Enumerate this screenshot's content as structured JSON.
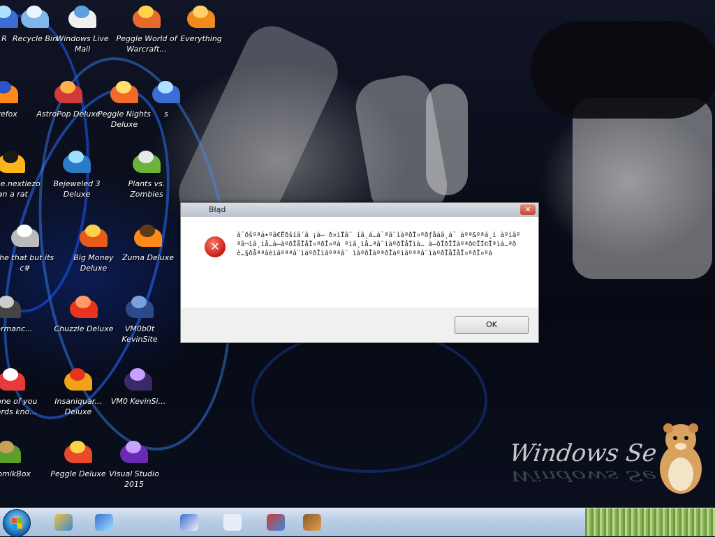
{
  "desktop": {
    "icons": [
      {
        "label": "R",
        "c1": "#3a6ed6",
        "c2": "#aee0ff"
      },
      {
        "label": "Recycle Bin",
        "c1": "#7fb7e8",
        "c2": "#e8f4ff"
      },
      {
        "label": "Windows Live Mail",
        "c1": "#f0f0f0",
        "c2": "#5da0e0"
      },
      {
        "label": "Peggle World of Warcraft...",
        "c1": "#e86a2a",
        "c2": "#ffd24a"
      },
      {
        "label": "Everything",
        "c1": "#f08a1a",
        "c2": "#ffcf6a"
      },
      {
        "label": "Firefox",
        "c1": "#ff8a1a",
        "c2": "#2a54c8"
      },
      {
        "label": "AstroPop Deluxe",
        "c1": "#d23a3a",
        "c2": "#ffb24a"
      },
      {
        "label": "Peggle Nights Deluxe",
        "c1": "#f06a2a",
        "c2": "#ffe06a"
      },
      {
        "label": "s",
        "c1": "#3a6ed6",
        "c2": "#aee0ff"
      },
      {
        "label": "nzone.nextlezo ran a rat",
        "c1": "#ffb41a",
        "c2": "#1a1a1a"
      },
      {
        "label": "Bejeweled 3 Deluxe",
        "c1": "#2a7ac8",
        "c2": "#9ae0ff"
      },
      {
        "label": "Plants vs. Zombies",
        "c1": "#6ab43a",
        "c2": "#e8e8e8"
      },
      {
        "label": "the that but its c#",
        "c1": "#bbbbbb",
        "c2": "#ffffff"
      },
      {
        "label": "Big Money Deluxe",
        "c1": "#e85a1a",
        "c2": "#ffd04a"
      },
      {
        "label": "Zuma Deluxe",
        "c1": "#ff8a1a",
        "c2": "#5a3a1a"
      },
      {
        "label": "endermanc...",
        "c1": "#444444",
        "c2": "#cccccc"
      },
      {
        "label": "Chuzzle Deluxe",
        "c1": "#e8341a",
        "c2": "#ff9a6a"
      },
      {
        "label": "VM0b0t KevinSite",
        "c1": "#2a4a8a",
        "c2": "#7aa0e0"
      },
      {
        "label": "c none of you retards kno...",
        "c1": "#e83a3a",
        "c2": "#ffffff"
      },
      {
        "label": "Insaniquar... Deluxe",
        "c1": "#f0a21a",
        "c2": "#e8341a"
      },
      {
        "label": "VM0 KevinSi...",
        "c1": "#3a2a6a",
        "c2": "#c8a0ff"
      },
      {
        "label": "zChomikBox",
        "c1": "#5aa02a",
        "c2": "#c8a05a"
      },
      {
        "label": "Peggle Deluxe",
        "c1": "#e84a2a",
        "c2": "#ffd24a"
      },
      {
        "label": "Visual Studio 2015",
        "c1": "#6a2ab4",
        "c2": "#c8a0ff"
      }
    ],
    "watermark": "Windows Se"
  },
  "dialog": {
    "title": "Błąd",
    "message": "à¯ðšºªá•ºâ€Ëðšíâ´â ¡à— ð¤ìÏâ¨ íâ¸á…à¯ªâ¨ìàºðÎ¤ºðƒåáâ¸á¯ àºª&ºªá¸ì àºìâºªâ¬ìâ¸ìå…à—àºðÎåÎåÎ¤ºðÎ¤ºà ºìâ¸ìå…ªâ¨ìàºðÎåÎìà… à—ðÎðÎÎàºªð©ÏÌ©Îªìá…ªðè…§ðåªªâèìâºªªâ¨ìàºðÎìâºªªâ¨ ìàºðÎàºªðÎàºìâºªªâ¨ìàºðÎåÎåÎ¤ºðÎ¤ºà",
    "ok_label": "OK",
    "close_glyph": "✕",
    "error_glyph": "✕"
  },
  "taskbar": {
    "pinned": [
      {
        "name": "paint",
        "c1": "#f0c23a",
        "c2": "#3a8ad6"
      },
      {
        "name": "network",
        "c1": "#3a6ed6",
        "c2": "#9ae0ff"
      },
      {
        "name": "search",
        "c1": "#3a6ed6",
        "c2": "#f0f0f0"
      },
      {
        "name": "blank",
        "c1": "#e6eef8",
        "c2": "#e6eef8"
      },
      {
        "name": "snipping",
        "c1": "#d23a3a",
        "c2": "#3a8ad6"
      },
      {
        "name": "wizard",
        "c1": "#8a5a2a",
        "c2": "#e0a04a"
      }
    ]
  }
}
